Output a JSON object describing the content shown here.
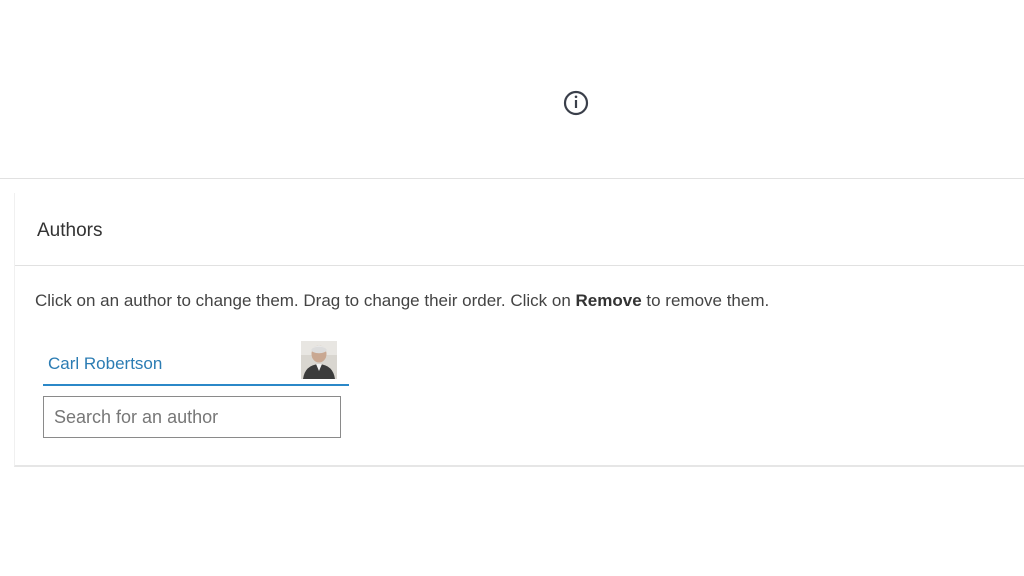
{
  "top": {
    "icon": "info-icon"
  },
  "authors_panel": {
    "title": "Authors",
    "instructions": {
      "part1": "Click on an author to change them. Drag to change their order. Click on ",
      "bold": "Remove",
      "part2": " to remove them."
    },
    "authors": [
      {
        "name": "Carl Robertson",
        "avatar_icon": "person-photo"
      }
    ],
    "search": {
      "placeholder": "Search for an author",
      "value": ""
    }
  },
  "colors": {
    "accent": "#2b88c8",
    "link": "#2b7cb3",
    "divider": "#e1e1e1"
  }
}
